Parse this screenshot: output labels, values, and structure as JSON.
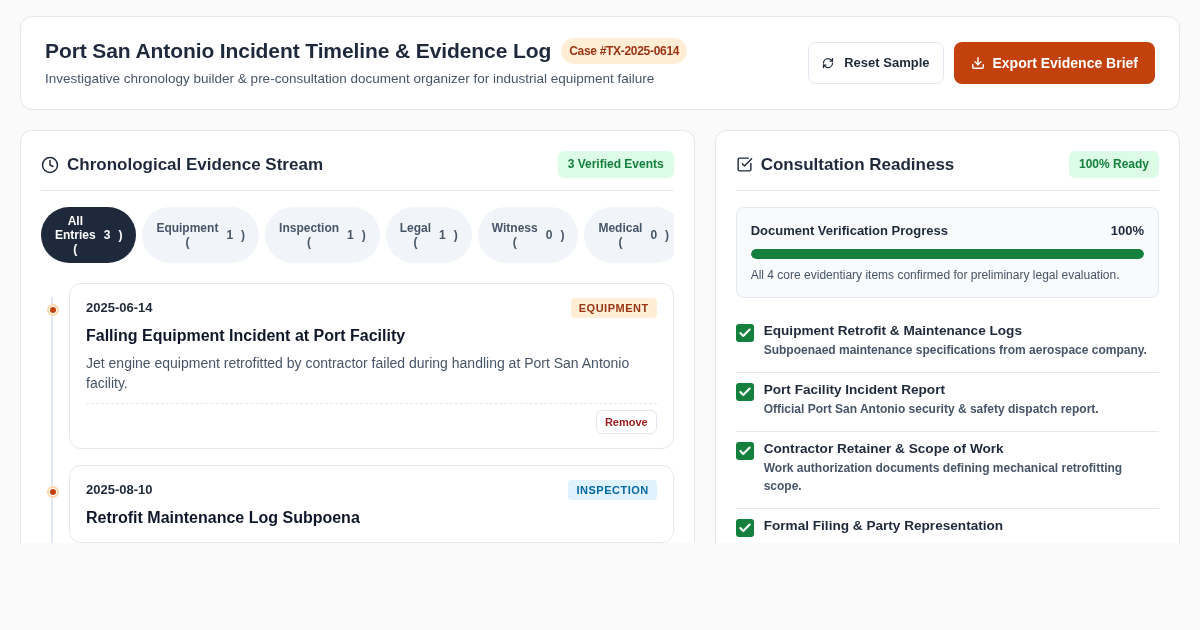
{
  "header": {
    "title": "Port San Antonio Incident Timeline & Evidence Log",
    "case_badge": "Case #TX-2025-0614",
    "subtitle": "Investigative chronology builder & pre-consultation document organizer for industrial equipment failure",
    "buttons": [
      {
        "label": "Reset Sample",
        "kind": "reset"
      },
      {
        "label": "Export Evidence Brief",
        "kind": "export"
      }
    ]
  },
  "timeline_panel": {
    "title": "Chronological Evidence Stream",
    "badge": "3 Verified Events",
    "filters": [
      {
        "label": "All Entries (",
        "count": "3",
        "suffix": ")",
        "selected": true
      },
      {
        "label": "Equipment (",
        "count": "1",
        "suffix": ")",
        "selected": false
      },
      {
        "label": "Inspection (",
        "count": "1",
        "suffix": ")",
        "selected": false
      },
      {
        "label": "Legal (",
        "count": "1",
        "suffix": ")",
        "selected": false
      },
      {
        "label": "Witness (",
        "count": "0",
        "suffix": ")",
        "selected": false
      },
      {
        "label": "Medical (",
        "count": "0",
        "suffix": ")",
        "selected": false
      }
    ],
    "events": [
      {
        "date": "2025-06-14",
        "category": "EQUIPMENT",
        "kind": "equipment",
        "title": "Falling Equipment Incident at Port Facility",
        "description": "Jet engine equipment retrofitted by contractor failed during handling at Port San Antonio facility.",
        "action": "Remove"
      },
      {
        "date": "2025-08-10",
        "category": "INSPECTION",
        "kind": "inspection",
        "title": "Retrofit Maintenance Log Subpoena"
      }
    ]
  },
  "readiness_panel": {
    "title": "Consultation Readiness",
    "badge": "100% Ready",
    "progress": {
      "label": "Document Verification Progress",
      "reading": "100%",
      "level": 1,
      "caption": "All 4 core evidentiary items confirmed for preliminary legal evaluation."
    },
    "checklist": [
      {
        "title": "Equipment Retrofit & Maintenance Logs",
        "description": "Subpoenaed maintenance specifications from aerospace company.",
        "checked": true
      },
      {
        "title": "Port Facility Incident Report",
        "description": "Official Port San Antonio security & safety dispatch report.",
        "checked": true
      },
      {
        "title": "Contractor Retainer & Scope of Work",
        "description": "Work authorization documents defining mechanical retrofitting scope.",
        "checked": true
      },
      {
        "title": "Formal Filing & Party Representation",
        "checked": true
      }
    ]
  }
}
